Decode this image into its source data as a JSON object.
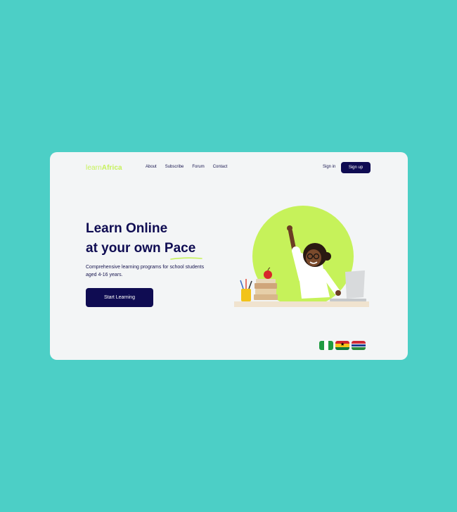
{
  "brand": {
    "prefix": "learn",
    "suffix": "Africa",
    "accent": "#c6f25a",
    "navy": "#0f0c52"
  },
  "nav": {
    "items": [
      "About",
      "Subscribe",
      "Forum",
      "Contact"
    ]
  },
  "auth": {
    "signin": "Sign in",
    "signup": "Sign up"
  },
  "hero": {
    "headline_line1": "Learn Online",
    "headline_line2": "at your own Pace",
    "description": "Comprehensive learning programs for school students aged 4-16 years.",
    "cta": "Start Learning"
  },
  "flags": [
    "nigeria-flag-icon",
    "ghana-flag-icon",
    "gambia-flag-icon"
  ],
  "background_color": "#4ccfc6"
}
